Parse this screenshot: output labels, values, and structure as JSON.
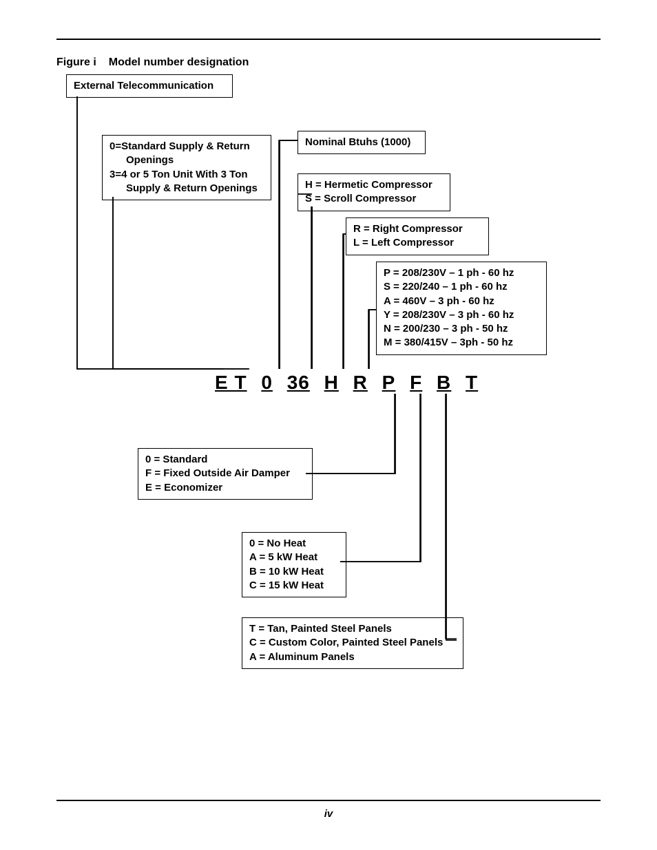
{
  "caption": {
    "fig": "Figure i",
    "title": "Model number designation"
  },
  "page_num": "iv",
  "model": {
    "p1": "E T",
    "p2": "0",
    "p3": "36",
    "p4": "H",
    "p5": "R",
    "p6": "P",
    "p7": "F",
    "p8": "B",
    "p9": "T"
  },
  "box": {
    "et": "External Telecommunication",
    "openings": {
      "l1": "0=Standard Supply & Return Openings",
      "l2": "3=4 or 5 Ton Unit With 3 Ton Supply & Return Openings"
    },
    "btuh": "Nominal Btuhs (1000)",
    "comp": {
      "l1": "H = Hermetic Compressor",
      "l2": "S = Scroll Compressor"
    },
    "side": {
      "l1": "R = Right Compressor",
      "l2": "L = Left Compressor"
    },
    "volt": {
      "l1": "P = 208/230V – 1 ph - 60 hz",
      "l2": "S = 220/240 – 1 ph - 60 hz",
      "l3": "A = 460V – 3 ph - 60 hz",
      "l4": "Y = 208/230V – 3 ph - 60 hz",
      "l5": "N = 200/230 – 3 ph - 50 hz",
      "l6": "M = 380/415V – 3ph - 50 hz"
    },
    "air": {
      "l1": "0 = Standard",
      "l2": "F = Fixed Outside Air Damper",
      "l3": "E = Economizer"
    },
    "heat": {
      "l1": "0 = No Heat",
      "l2": "A = 5 kW Heat",
      "l3": "B = 10 kW Heat",
      "l4": "C = 15 kW Heat"
    },
    "panel": {
      "l1": "T = Tan, Painted Steel Panels",
      "l2": "C = Custom Color, Painted Steel Panels",
      "l3": "A = Aluminum Panels"
    }
  }
}
